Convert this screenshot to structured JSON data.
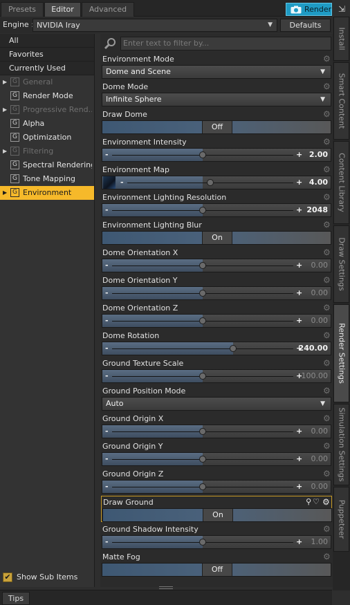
{
  "tabs": [
    {
      "label": "Presets",
      "active": false
    },
    {
      "label": "Editor",
      "active": true
    },
    {
      "label": "Advanced",
      "active": false
    }
  ],
  "render_button": {
    "label": "Render",
    "icon": "camera-icon",
    "color": "#1f9bc4"
  },
  "pin_icon": "pin-icon",
  "engine": {
    "label": "Engine :",
    "value": "NVIDIA Iray",
    "defaults_label": "Defaults"
  },
  "filters": [
    "All",
    "Favorites",
    "Currently Used"
  ],
  "categories": [
    {
      "label": "General",
      "expandable": true,
      "disabled": true,
      "selected": false
    },
    {
      "label": "Render Mode",
      "expandable": false,
      "disabled": false,
      "selected": false
    },
    {
      "label": "Progressive Rend...",
      "expandable": true,
      "disabled": true,
      "selected": false
    },
    {
      "label": "Alpha",
      "expandable": false,
      "disabled": false,
      "selected": false
    },
    {
      "label": "Optimization",
      "expandable": false,
      "disabled": false,
      "selected": false
    },
    {
      "label": "Filtering",
      "expandable": true,
      "disabled": true,
      "selected": false
    },
    {
      "label": "Spectral Rendering",
      "expandable": false,
      "disabled": false,
      "selected": false
    },
    {
      "label": "Tone Mapping",
      "expandable": false,
      "disabled": false,
      "selected": false
    },
    {
      "label": "Environment",
      "expandable": true,
      "disabled": false,
      "selected": true
    }
  ],
  "category_icon_glyph": "G",
  "show_sub_items": {
    "label": "Show Sub Items",
    "checked": true
  },
  "filter_placeholder": "Enter text to filter by...",
  "properties": [
    {
      "name": "Environment Mode",
      "type": "dropdown",
      "value": "Dome and Scene"
    },
    {
      "name": "Dome Mode",
      "type": "dropdown",
      "value": "Infinite Sphere"
    },
    {
      "name": "Draw Dome",
      "type": "toggle",
      "value": "Off"
    },
    {
      "name": "Environment Intensity",
      "type": "slider",
      "value": "2.00",
      "position": 0.5,
      "strong": true
    },
    {
      "name": "Environment Map",
      "type": "slider",
      "value": "4.00",
      "position": 0.5,
      "strong": true,
      "thumb": true
    },
    {
      "name": "Environment Lighting Resolution",
      "type": "slider",
      "value": "2048",
      "position": 0.5,
      "strong": true
    },
    {
      "name": "Environment Lighting Blur",
      "type": "toggle",
      "value": "On"
    },
    {
      "name": "Dome Orientation X",
      "type": "slider",
      "value": "0.00",
      "position": 0.5,
      "strong": false
    },
    {
      "name": "Dome Orientation Y",
      "type": "slider",
      "value": "0.00",
      "position": 0.5,
      "strong": false
    },
    {
      "name": "Dome Orientation Z",
      "type": "slider",
      "value": "0.00",
      "position": 0.5,
      "strong": false
    },
    {
      "name": "Dome Rotation",
      "type": "slider",
      "value": "240.00",
      "position": 0.667,
      "strong": true
    },
    {
      "name": "Ground Texture Scale",
      "type": "slider",
      "value": "100.00",
      "position": 0.5,
      "strong": false
    },
    {
      "name": "Ground Position Mode",
      "type": "dropdown",
      "value": "Auto"
    },
    {
      "name": "Ground Origin X",
      "type": "slider",
      "value": "0.00",
      "position": 0.5,
      "strong": false
    },
    {
      "name": "Ground Origin Y",
      "type": "slider",
      "value": "0.00",
      "position": 0.5,
      "strong": false
    },
    {
      "name": "Ground Origin Z",
      "type": "slider",
      "value": "0.00",
      "position": 0.5,
      "strong": false
    },
    {
      "name": "Draw Ground",
      "type": "toggle",
      "value": "On",
      "highlighted": true
    },
    {
      "name": "Ground Shadow Intensity",
      "type": "slider",
      "value": "1.00",
      "position": 0.5,
      "strong": false
    },
    {
      "name": "Matte Fog",
      "type": "toggle",
      "value": "Off"
    }
  ],
  "side_tabs": [
    {
      "label": "Install",
      "active": false
    },
    {
      "label": "Smart Content",
      "active": false
    },
    {
      "label": "Content Library",
      "active": false
    },
    {
      "label": "Draw Settings",
      "active": false
    },
    {
      "label": "Render Settings",
      "active": true
    },
    {
      "label": "Simulation Settings",
      "active": false
    },
    {
      "label": "Puppeteer",
      "active": false
    }
  ],
  "bottom_tab": "Tips"
}
